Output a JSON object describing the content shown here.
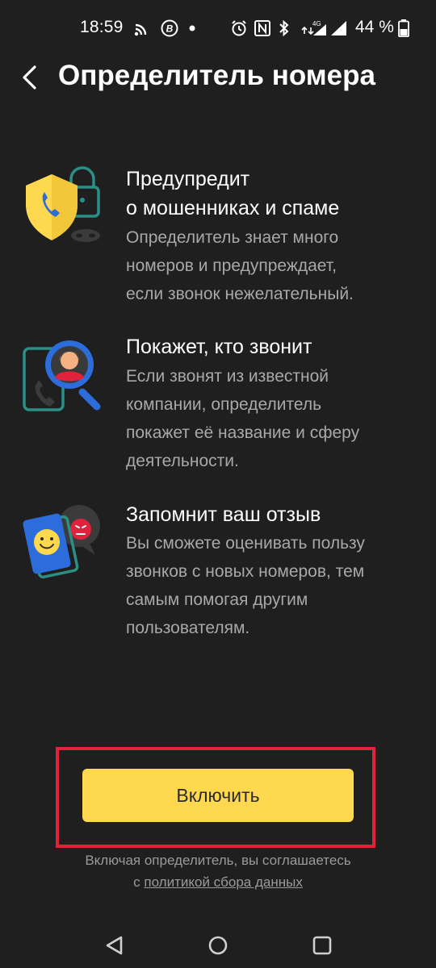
{
  "status_bar": {
    "time": "18:59",
    "battery_percent": "44 %",
    "network_label": "4G",
    "icons": [
      "cast-icon",
      "b-circle-icon",
      "dot-icon",
      "alarm-icon",
      "nfc-icon",
      "bluetooth-icon",
      "mobile-data-icon",
      "signal-icon",
      "signal-icon-2",
      "battery-icon"
    ]
  },
  "header": {
    "back_icon": "chevron-left-icon",
    "title": "Определитель номера"
  },
  "features": [
    {
      "icon": "shield-phone-lock-illustration",
      "title_line1": "Предупредит",
      "title_line2": "о мошенниках и спаме",
      "description": [
        "Определитель знает много",
        "номеров и предупреждает,",
        "если звонок нежелательный."
      ]
    },
    {
      "icon": "magnifier-caller-illustration",
      "title": "Покажет, кто звонит",
      "description": [
        "Если звонят из известной",
        "компании, определитель",
        "покажет её название и сферу",
        "деятельности."
      ]
    },
    {
      "icon": "smiley-feedback-illustration",
      "title": "Запомнит ваш отзыв",
      "description": [
        "Вы сможете оценивать пользу",
        "звонков с новых номеров, тем",
        "самым помогая другим",
        "пользователям."
      ]
    }
  ],
  "action": {
    "enable_label": "Включить",
    "consent_line1": "Включая определитель, вы соглашаетесь",
    "consent_prefix": "с ",
    "consent_link": "политикой сбора данных"
  },
  "colors": {
    "background": "#1f1f1f",
    "accent_yellow": "#fed94f",
    "highlight_red": "#e0223a",
    "secondary_text": "#a8a8a8"
  },
  "nav_bar": {
    "icons": [
      "back-triangle-icon",
      "home-circle-icon",
      "recents-square-icon"
    ]
  }
}
